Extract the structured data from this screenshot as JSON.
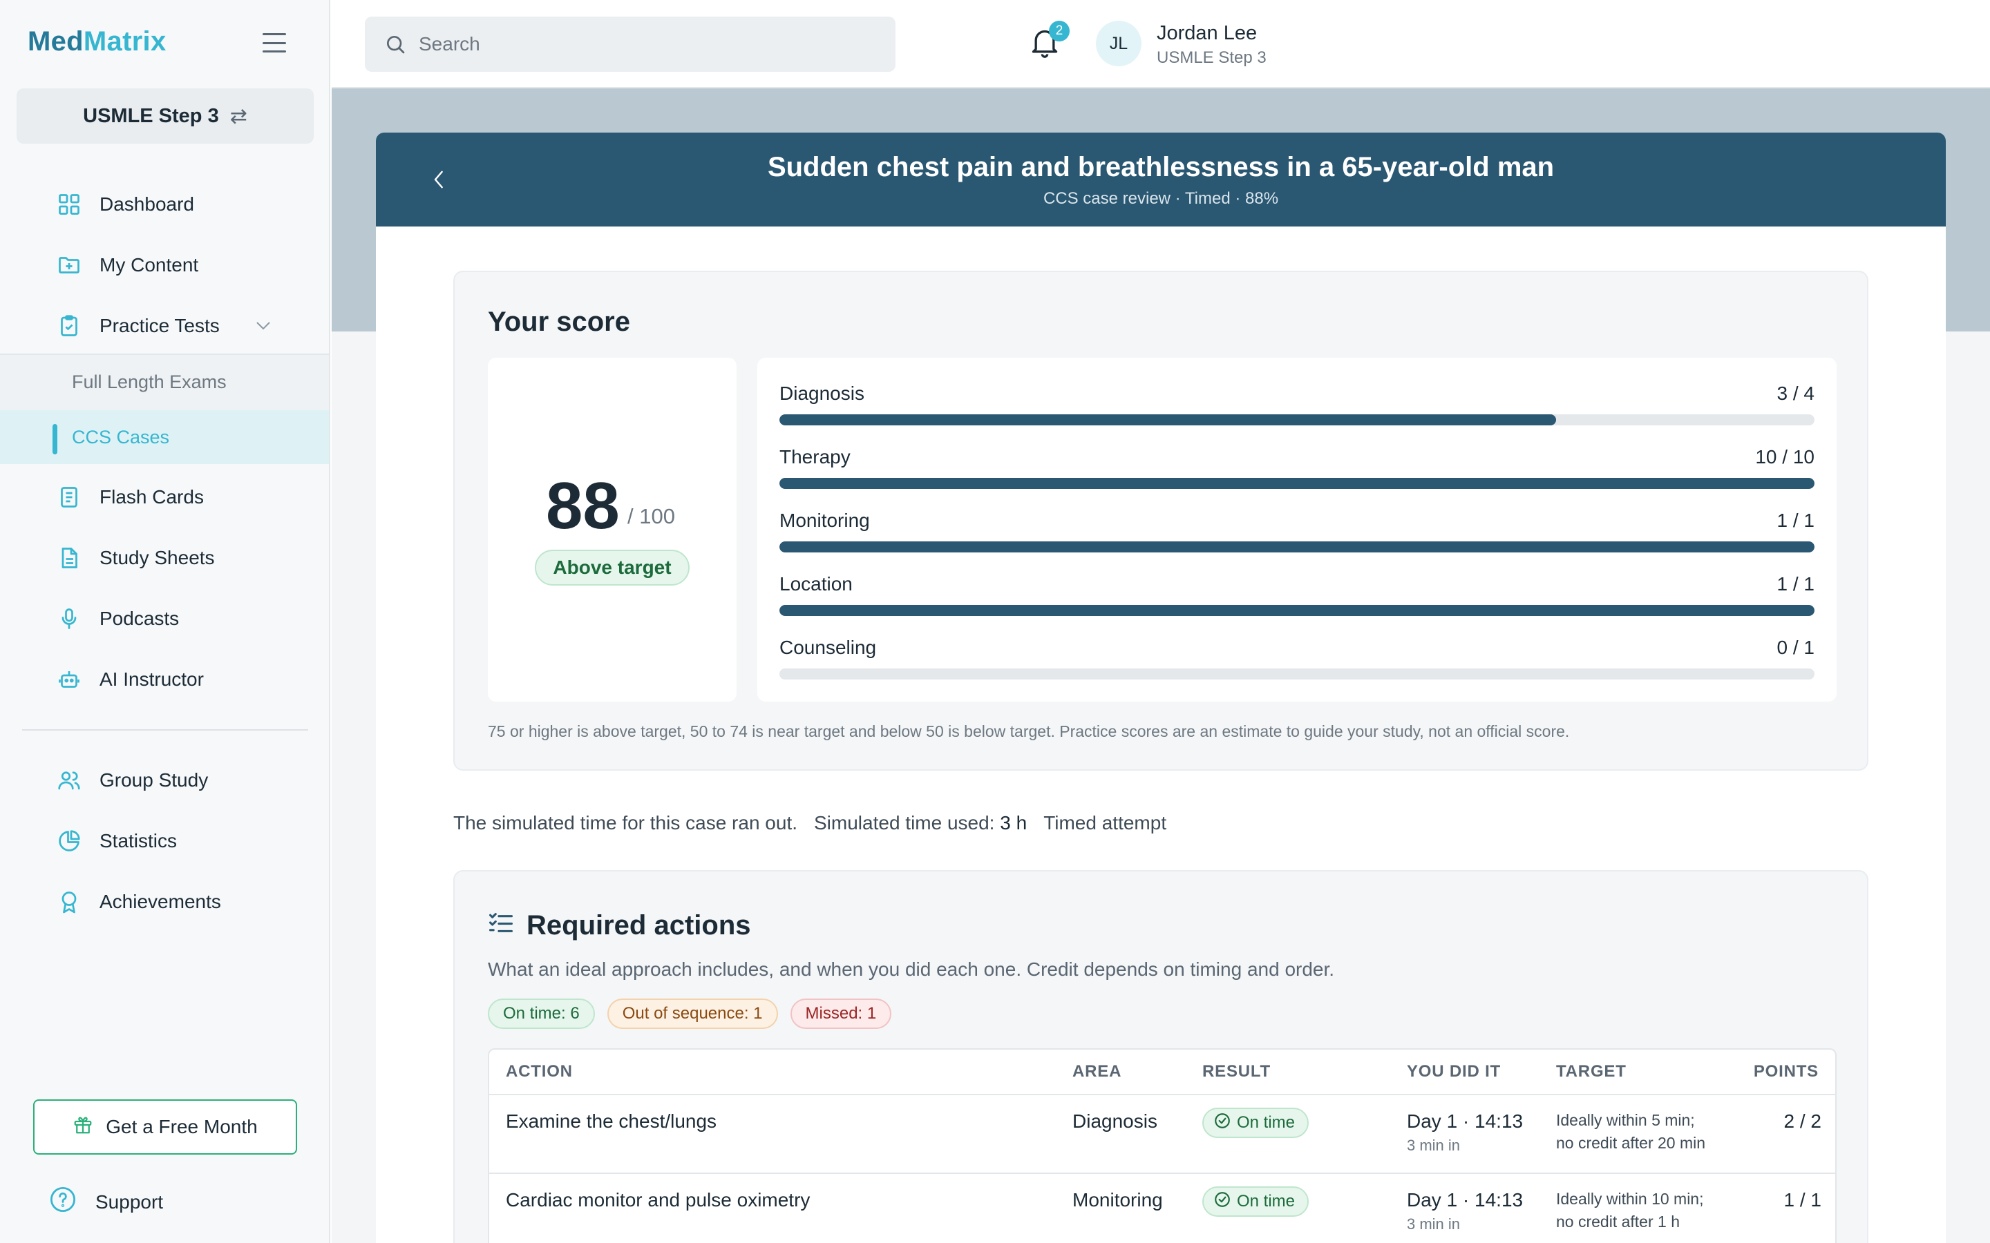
{
  "app": {
    "brand_first": "Med",
    "brand_second": "Matrix",
    "exam_switch": "USMLE Step 3",
    "accent": "#36b6d0",
    "header_color": "#2a5771"
  },
  "sidebar": {
    "items": [
      {
        "label": "Dashboard",
        "icon": "grid-icon"
      },
      {
        "label": "My Content",
        "icon": "folder-plus-icon"
      },
      {
        "label": "Practice Tests",
        "icon": "clipboard-check-icon"
      },
      {
        "label": "Flash Cards",
        "icon": "book-icon"
      },
      {
        "label": "Study Sheets",
        "icon": "document-icon"
      },
      {
        "label": "Podcasts",
        "icon": "microphone-icon"
      },
      {
        "label": "AI Instructor",
        "icon": "robot-icon"
      },
      {
        "label": "Group Study",
        "icon": "users-icon"
      },
      {
        "label": "Statistics",
        "icon": "pie-chart-icon"
      },
      {
        "label": "Achievements",
        "icon": "award-icon"
      }
    ],
    "subitems": [
      {
        "label": "Full Length Exams"
      },
      {
        "label": "CCS Cases",
        "active": true
      }
    ],
    "free_month": "Get a Free Month",
    "support": "Support"
  },
  "topbar": {
    "search_placeholder": "Search",
    "notifications": "2",
    "avatar_initials": "JL",
    "user_name": "Jordan Lee",
    "user_exam": "USMLE Step 3"
  },
  "case": {
    "title": "Sudden chest pain and breathlessness in a 65-year-old man",
    "subtitle": "CCS case review · Timed · 88%"
  },
  "score": {
    "heading": "Your score",
    "value": "88",
    "denominator": "/ 100",
    "status": "Above target",
    "categories": [
      {
        "name": "Diagnosis",
        "score": "3 / 4",
        "fraction": 0.75
      },
      {
        "name": "Therapy",
        "score": "10 / 10",
        "fraction": 1.0
      },
      {
        "name": "Monitoring",
        "score": "1 / 1",
        "fraction": 1.0
      },
      {
        "name": "Location",
        "score": "1 / 1",
        "fraction": 1.0
      },
      {
        "name": "Counseling",
        "score": "0 / 1",
        "fraction": 0.0
      }
    ],
    "note": "75 or higher is above target, 50 to 74 is near target and below 50 is below target. Practice scores are an estimate to guide your study, not an official score."
  },
  "simulation": {
    "message": "The simulated time for this case ran out.",
    "time_label": "Simulated time used:",
    "time_value": "3 h",
    "mode": "Timed attempt"
  },
  "required": {
    "heading": "Required actions",
    "description": "What an ideal approach includes, and when you did each one. Credit depends on timing and order.",
    "chips": {
      "on_time": "On time: 6",
      "out_of_sequence": "Out of sequence: 1",
      "missed": "Missed: 1"
    },
    "columns": {
      "action": "ACTION",
      "area": "AREA",
      "result": "RESULT",
      "you_did_it": "YOU DID IT",
      "target": "TARGET",
      "points": "POINTS"
    },
    "rows": [
      {
        "action": "Examine the chest/lungs",
        "area": "Diagnosis",
        "result": "On time",
        "when": "Day 1 · 14:13",
        "elapsed": "3 min in",
        "target_line1": "Ideally within 5 min;",
        "target_line2": "no credit after 20 min",
        "points": "2 / 2"
      },
      {
        "action": "Cardiac monitor and pulse oximetry",
        "area": "Monitoring",
        "result": "On time",
        "when": "Day 1 · 14:13",
        "elapsed": "3 min in",
        "target_line1": "Ideally within 10 min;",
        "target_line2": "no credit after 1 h",
        "points": "1 / 1"
      }
    ]
  }
}
